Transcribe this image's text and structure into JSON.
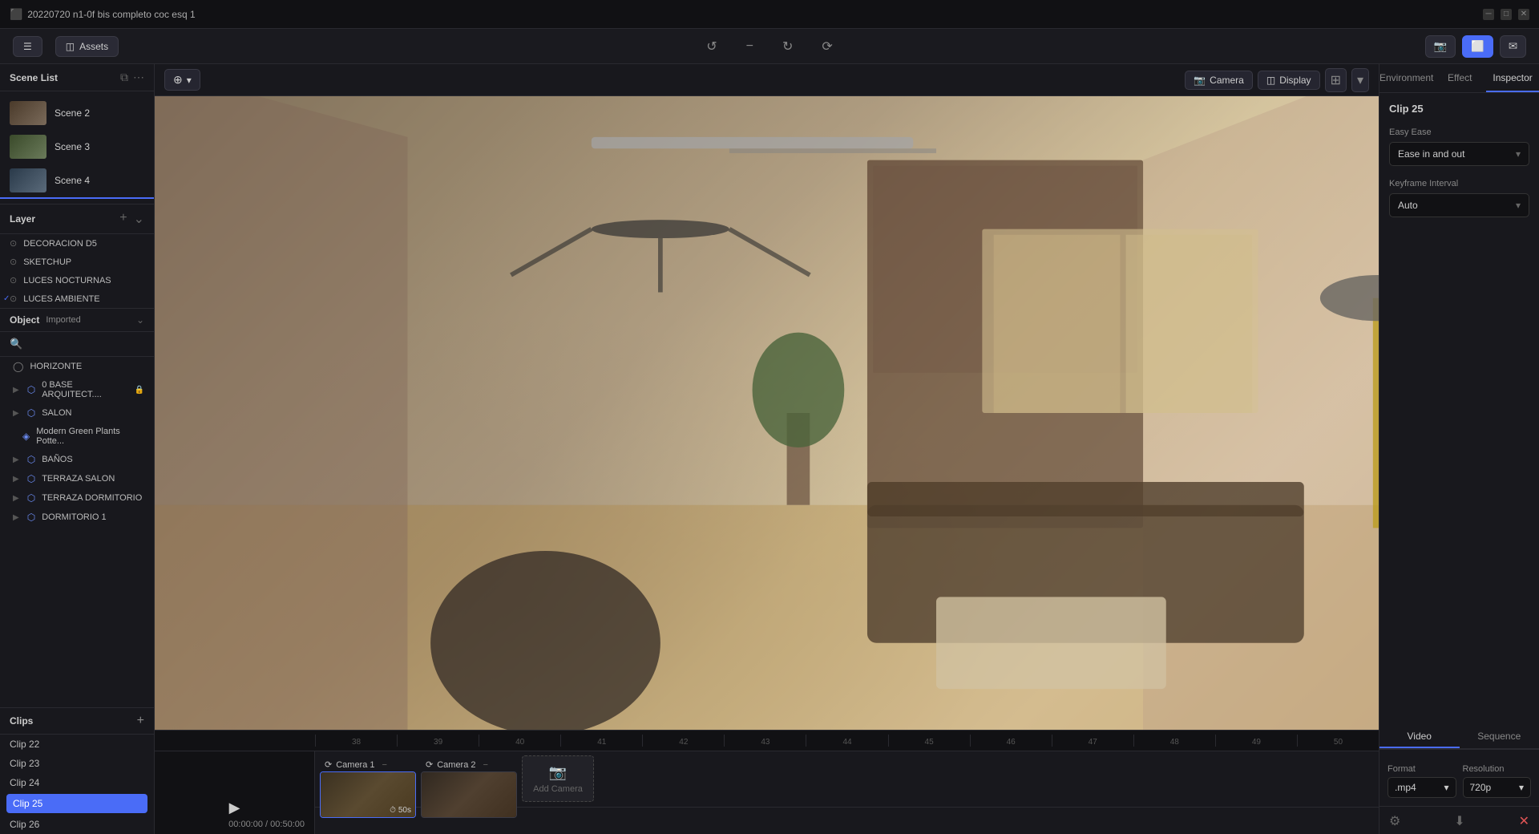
{
  "titlebar": {
    "title": "20220720 n1-0f bis completo coc esq 1"
  },
  "toolbar": {
    "assets_label": "Assets",
    "undo_tooltip": "Undo",
    "redo_tooltip": "Redo",
    "icons_center": [
      "rotate-left",
      "minus",
      "rotate-right",
      "refresh"
    ],
    "screenshot_tooltip": "Screenshot",
    "share_tooltip": "Share",
    "active_btn": "viewport"
  },
  "scene_list": {
    "title": "Scene List",
    "scenes": [
      {
        "label": "Scene 2"
      },
      {
        "label": "Scene 3"
      },
      {
        "label": "Scene 4"
      }
    ]
  },
  "layers": {
    "title": "Layer",
    "items": [
      {
        "name": "DECORACION D5",
        "active": false
      },
      {
        "name": "SKETCHUP",
        "active": false
      },
      {
        "name": "LUCES NOCTURNAS",
        "active": false
      },
      {
        "name": "LUCES AMBIENTE",
        "active": true
      }
    ]
  },
  "object": {
    "title": "Object",
    "filter": "Imported",
    "items": [
      {
        "name": "HORIZONTE",
        "icon": "globe",
        "indent": 0
      },
      {
        "name": "0 BASE ARQUITECT....",
        "icon": "group",
        "indent": 0,
        "lock": true
      },
      {
        "name": "SALON",
        "icon": "group",
        "indent": 0
      },
      {
        "name": "Modern Green Plants Potte...",
        "icon": "mesh",
        "indent": 1
      },
      {
        "name": "BAÑOS",
        "icon": "group",
        "indent": 0
      },
      {
        "name": "TERRAZA SALON",
        "icon": "group",
        "indent": 0
      },
      {
        "name": "TERRAZA DORMITORIO",
        "icon": "group",
        "indent": 0
      },
      {
        "name": "DORMITORIO 1",
        "icon": "group",
        "indent": 0
      }
    ],
    "search_placeholder": ""
  },
  "clips": {
    "title": "Clips",
    "items": [
      {
        "label": "Clip 22"
      },
      {
        "label": "Clip 23"
      },
      {
        "label": "Clip 24"
      },
      {
        "label": "Clip 25",
        "active": true
      },
      {
        "label": "Clip 26"
      }
    ]
  },
  "viewport": {
    "camera_btn": "Camera",
    "display_btn": "Display"
  },
  "timeline": {
    "ruler_marks": [
      "38",
      "39",
      "40",
      "41",
      "42",
      "43",
      "44",
      "45",
      "46",
      "47",
      "48",
      "49",
      "50"
    ],
    "time_current": "00:00:00",
    "time_total": "00:50:00",
    "cameras": [
      {
        "label": "Camera 1",
        "duration": "50s"
      },
      {
        "label": "Camera 2",
        "duration": ""
      }
    ],
    "add_camera_label": "Add Camera"
  },
  "right_panel": {
    "tabs": [
      {
        "label": "Environment"
      },
      {
        "label": "Effect"
      },
      {
        "label": "Inspector",
        "active": true
      }
    ],
    "clip_label": "Clip 25",
    "easy_ease_label": "Easy Ease",
    "ease_dropdown": "Ease in and out",
    "keyframe_label": "Keyframe Interval",
    "keyframe_dropdown": "Auto",
    "render_tabs": [
      {
        "label": "Video",
        "active": true
      },
      {
        "label": "Sequence"
      }
    ],
    "format_label": "Format",
    "resolution_label": "Resolution",
    "format_value": ".mp4",
    "resolution_value": "720p"
  }
}
